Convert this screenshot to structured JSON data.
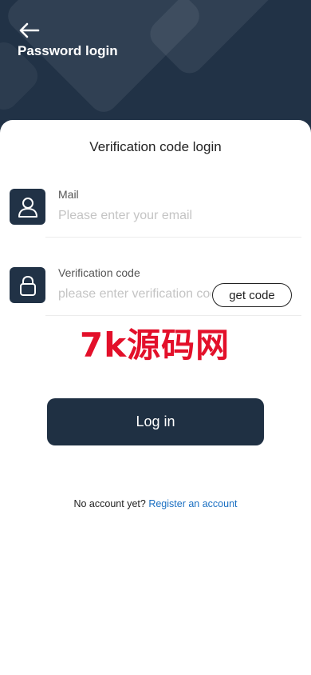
{
  "header": {
    "back_icon": "arrow-left-icon",
    "title": "Password login"
  },
  "card": {
    "title": "Verification code login",
    "mail": {
      "icon": "user-icon",
      "label": "Mail",
      "placeholder": "Please enter your email",
      "value": ""
    },
    "code": {
      "icon": "lock-icon",
      "label": "Verification code",
      "placeholder": "please enter verification code",
      "value": "",
      "get_code_label": "get code"
    },
    "watermark": "7k源码网",
    "login_label": "Log in",
    "register": {
      "prompt": "No account yet?",
      "link": "Register an account"
    }
  },
  "colors": {
    "header_bg": "#213246",
    "button_bg": "#1f3043",
    "link": "#1a6fc2",
    "watermark": "#e3102a"
  }
}
